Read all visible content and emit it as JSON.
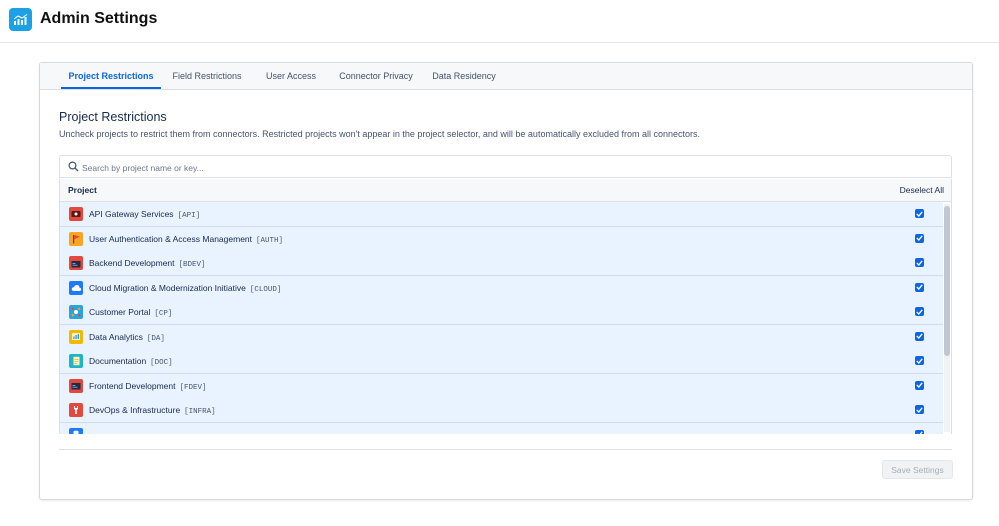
{
  "app": {
    "title": "Admin Settings",
    "logo_icon": "chart-icon",
    "brand_color": "#1da1e6"
  },
  "tabs": [
    {
      "label": "Project Restrictions",
      "active": true
    },
    {
      "label": "Field Restrictions",
      "active": false
    },
    {
      "label": "User Access",
      "active": false
    },
    {
      "label": "Connector Privacy",
      "active": false
    },
    {
      "label": "Data Residency",
      "active": false
    }
  ],
  "section": {
    "title": "Project Restrictions",
    "description": "Uncheck projects to restrict them from connectors. Restricted projects won't appear in the project selector, and will be automatically excluded from all connectors."
  },
  "search": {
    "placeholder": "Search by project name or key...",
    "value": ""
  },
  "table": {
    "column_project": "Project",
    "deselect_all": "Deselect All",
    "rows": [
      {
        "name": "API Gateway Services",
        "key": "[API]",
        "icon": "gateway-icon",
        "icon_color": "#e2483d",
        "checked": true
      },
      {
        "name": "User Authentication & Access Management",
        "key": "[AUTH]",
        "icon": "flag-icon",
        "icon_color": "#f5a623",
        "checked": true
      },
      {
        "name": "Backend Development",
        "key": "[BDEV]",
        "icon": "terminal-icon",
        "icon_color": "#e2483d",
        "checked": true
      },
      {
        "name": "Cloud Migration & Modernization Initiative",
        "key": "[CLOUD]",
        "icon": "cloud-icon",
        "icon_color": "#1d7afc",
        "checked": true
      },
      {
        "name": "Customer Portal",
        "key": "[CP]",
        "icon": "portal-icon",
        "icon_color": "#2ba3e0",
        "checked": true
      },
      {
        "name": "Data Analytics",
        "key": "[DA]",
        "icon": "analytics-icon",
        "icon_color": "#f5b800",
        "checked": true
      },
      {
        "name": "Documentation",
        "key": "[DOC]",
        "icon": "document-icon",
        "icon_color": "#1fb5c9",
        "checked": true
      },
      {
        "name": "Frontend Development",
        "key": "[FDEV]",
        "icon": "terminal-icon",
        "icon_color": "#e2483d",
        "checked": true
      },
      {
        "name": "DevOps & Infrastructure",
        "key": "[INFRA]",
        "icon": "wrench-icon",
        "icon_color": "#e2483d",
        "checked": true
      },
      {
        "name": "",
        "key": "",
        "icon": "mobile-icon",
        "icon_color": "#1d7afc",
        "checked": true
      }
    ]
  },
  "footer": {
    "save_label": "Save Settings",
    "save_disabled": true
  },
  "colors": {
    "accent": "#0c66e4",
    "row_selected": "#e9f2ff"
  }
}
